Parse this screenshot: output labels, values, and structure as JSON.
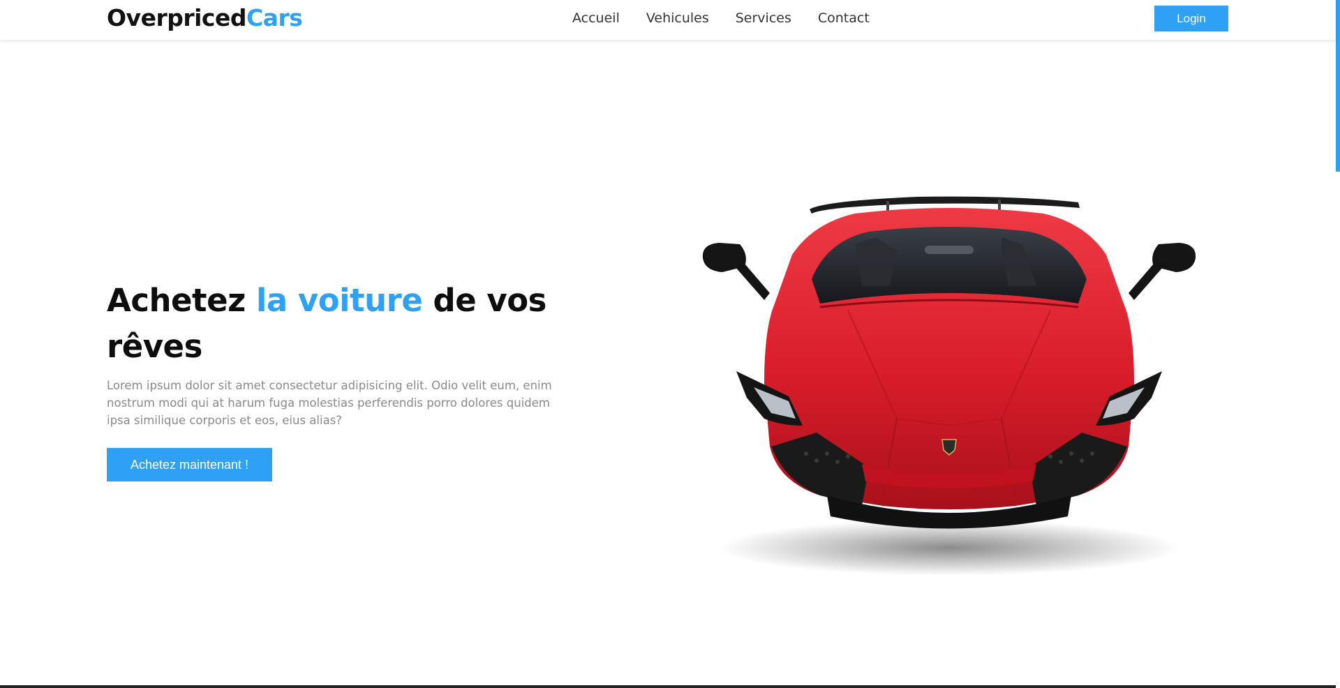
{
  "header": {
    "brand": {
      "part1": "Overpriced",
      "part2": "Cars"
    },
    "nav": [
      {
        "label": "Accueil"
      },
      {
        "label": "Vehicules"
      },
      {
        "label": "Services"
      },
      {
        "label": "Contact"
      }
    ],
    "login_label": "Login"
  },
  "hero": {
    "title": {
      "part1": "Achetez ",
      "accent": "la voiture",
      "part2": " de vos rêves"
    },
    "text": "Lorem ipsum dolor sit amet consectetur adipisicing elit. Odio velit eum, enim nostrum modi qui at harum fuga molestias perferendis porro dolores quidem ipsa similique corporis et eos, eius alias?",
    "cta_label": "Achetez maintenant !"
  },
  "colors": {
    "accent": "#2ea1f5",
    "car_body": "#e0202c",
    "text_dark": "#0d0d0d",
    "text_muted": "#8a8a8a"
  },
  "icons": {
    "hero_image": "red-sports-car"
  }
}
